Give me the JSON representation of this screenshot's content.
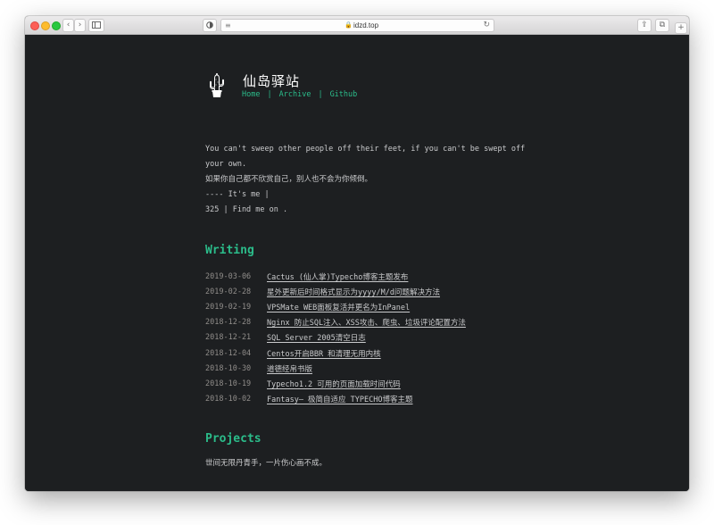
{
  "browser": {
    "url": "idzd.top",
    "nav_back": "‹",
    "nav_forward": "›",
    "reload": "↻",
    "share": "⇪",
    "tabs": "⧉",
    "new_tab": "+"
  },
  "site": {
    "title": "仙岛驿站",
    "nav": [
      {
        "label": "Home"
      },
      {
        "label": "Archive"
      },
      {
        "label": "Github"
      }
    ],
    "nav_sep": "|"
  },
  "intro": {
    "line1": "You can't sweep other people off their feet, if you can't be swept off your own.",
    "line2": "如果你自己都不欣赏自己，别人也不会为你倾倒。",
    "line3": "---- It's me |",
    "line4": "325 | Find me on ."
  },
  "writing": {
    "heading": "Writing",
    "posts": [
      {
        "date": "2019-03-06",
        "title": "Cactus (仙人掌)Typecho博客主题发布"
      },
      {
        "date": "2019-02-28",
        "title": "星外更新后时间格式显示为yyyy/M/d问题解决方法"
      },
      {
        "date": "2019-02-19",
        "title": "VPSMate WEB面板复活并更名为InPanel"
      },
      {
        "date": "2018-12-28",
        "title": "Nginx 防止SQL注入、XSS攻击、爬虫、垃圾评论配置方法"
      },
      {
        "date": "2018-12-21",
        "title": "SQL Server 2005清空日志"
      },
      {
        "date": "2018-12-04",
        "title": "Centos开启BBR 和清理无用内核"
      },
      {
        "date": "2018-10-30",
        "title": "道德经帛书版"
      },
      {
        "date": "2018-10-19",
        "title": "Typecho1.2 可用的页面加载时间代码"
      },
      {
        "date": "2018-10-02",
        "title": "Fantasy— 极简自适应 TYPECHO博客主题"
      }
    ]
  },
  "projects": {
    "heading": "Projects",
    "text": "世间无限丹青手，一片伤心画不成。"
  },
  "colors": {
    "accent": "#2bbc8a",
    "background": "#1d1f21",
    "text": "#c9cacc",
    "date": "#908d8a"
  }
}
